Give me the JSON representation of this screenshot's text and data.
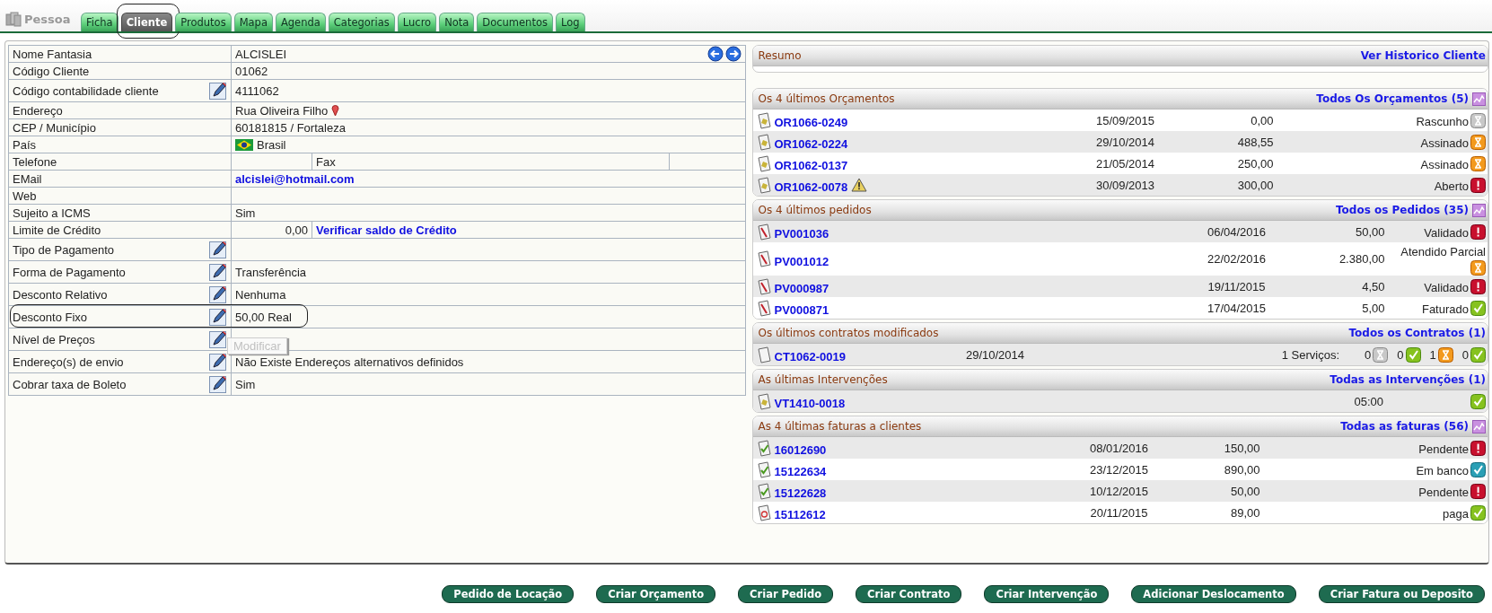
{
  "header": {
    "title": "Pessoa"
  },
  "tabs": [
    {
      "label": "Ficha",
      "selected": false,
      "highlighted": false
    },
    {
      "label": "Cliente",
      "selected": true,
      "highlighted": true
    },
    {
      "label": "Produtos",
      "selected": false,
      "highlighted": false
    },
    {
      "label": "Mapa",
      "selected": false,
      "highlighted": false
    },
    {
      "label": "Agenda",
      "selected": false,
      "highlighted": false
    },
    {
      "label": "Categorias",
      "selected": false,
      "highlighted": false
    },
    {
      "label": "Lucro",
      "selected": false,
      "highlighted": false
    },
    {
      "label": "Nota",
      "selected": false,
      "highlighted": false
    },
    {
      "label": "Documentos",
      "selected": false,
      "highlighted": false
    },
    {
      "label": "Log",
      "selected": false,
      "highlighted": false
    }
  ],
  "fields": [
    {
      "kind": "nav",
      "label": "Nome Fantasia",
      "value": "ALCISLEI",
      "editable": false
    },
    {
      "kind": "text",
      "label": "Código Cliente",
      "value": "01062",
      "editable": false
    },
    {
      "kind": "text",
      "label": "Código contabilidade cliente",
      "value": "4111062",
      "editable": true
    },
    {
      "kind": "address",
      "label": "Endereço",
      "value": "Rua Oliveira Filho",
      "editable": false
    },
    {
      "kind": "text",
      "label": "CEP / Município",
      "value": "60181815 / Fortaleza",
      "editable": false
    },
    {
      "kind": "country",
      "label": "País",
      "value": "Brasil",
      "editable": false
    },
    {
      "kind": "phone",
      "label": "Telefone",
      "fax_label": "Fax",
      "editable": false
    },
    {
      "kind": "email",
      "label": "EMail",
      "value": "alcislei@hotmail.com",
      "editable": false
    },
    {
      "kind": "text",
      "label": "Web",
      "editable": false
    },
    {
      "kind": "text",
      "label": "Sujeito a ICMS",
      "value": "Sim",
      "editable": false
    },
    {
      "kind": "credit",
      "label": "Limite de Crédito",
      "value": "0,00",
      "link": "Verificar saldo de Crédito",
      "editable": false
    },
    {
      "kind": "text",
      "label": "Tipo de Pagamento",
      "editable": true
    },
    {
      "kind": "text",
      "label": "Forma de Pagamento",
      "value": "Transferência",
      "editable": true
    },
    {
      "kind": "text",
      "label": "Desconto Relativo",
      "value": "Nenhuma",
      "editable": true
    },
    {
      "kind": "text",
      "label": "Desconto Fixo",
      "value": "50,00 Real",
      "editable": true,
      "highlighted": true
    },
    {
      "kind": "text",
      "label": "Nível de Preços",
      "editable": true
    },
    {
      "kind": "text",
      "label": "Endereço(s) de envio",
      "value": "Não Existe Endereços alternativos definidos",
      "editable": true
    },
    {
      "kind": "text",
      "label": "Cobrar taxa de Boleto",
      "value": "Sim",
      "editable": true
    }
  ],
  "tooltip": {
    "text": "Modificar"
  },
  "sections": [
    {
      "kind": "summary",
      "title": "Resumo",
      "link": "Ver Historico Cliente",
      "graph_icon": false
    },
    {
      "kind": "quotes",
      "title": "Os 4 últimos Orçamentos",
      "link": "Todos Os Orçamentos (5)",
      "graph_icon": true,
      "rows": [
        {
          "kind": "quote",
          "ref": "OR1066-0249",
          "warning": false,
          "date": "15/09/2015",
          "amount": "0,00",
          "status_text": "Rascunho",
          "status": {
            "kind": "draft"
          }
        },
        {
          "kind": "quote",
          "ref": "OR1062-0224",
          "warning": false,
          "date": "29/10/2014",
          "amount": "488,55",
          "status_text": "Assinado",
          "status": {
            "kind": "waiting"
          }
        },
        {
          "kind": "quote",
          "ref": "OR1062-0137",
          "warning": false,
          "date": "21/05/2014",
          "amount": "250,00",
          "status_text": "Assinado",
          "status": {
            "kind": "waiting"
          }
        },
        {
          "kind": "quote",
          "ref": "OR1062-0078",
          "warning": true,
          "date": "30/09/2013",
          "amount": "300,00",
          "status_text": "Aberto",
          "status": {
            "kind": "alert"
          }
        }
      ]
    },
    {
      "kind": "orders",
      "title": "Os 4 últimos pedidos",
      "link": "Todos os Pedidos (35)",
      "graph_icon": true,
      "rows": [
        {
          "kind": "order",
          "ref": "PV001036",
          "warning": false,
          "date": "06/04/2016",
          "amount": "50,00",
          "status_text": "Validado",
          "status": {
            "kind": "alert"
          }
        },
        {
          "kind": "order",
          "ref": "PV001012",
          "warning": false,
          "date": "22/02/2016",
          "amount": "2.380,00",
          "status_text": "Atendido Parcial",
          "status": {
            "kind": "waiting"
          }
        },
        {
          "kind": "order",
          "ref": "PV000987",
          "warning": false,
          "date": "19/11/2015",
          "amount": "4,50",
          "status_text": "Validado",
          "status": {
            "kind": "alert"
          }
        },
        {
          "kind": "order",
          "ref": "PV000871",
          "warning": false,
          "date": "17/04/2015",
          "amount": "5,00",
          "status_text": "Faturado",
          "status": {
            "kind": "done"
          }
        }
      ]
    },
    {
      "kind": "contracts",
      "title": "Os últimos contratos modificados",
      "link": "Todos os Contratos (1)",
      "graph_icon": false,
      "rows": [
        {
          "kind": "contract",
          "ref": "CT1062-0019",
          "warning": false,
          "date": "29/10/2014",
          "services_label": "1 Serviços:",
          "counts": [
            {
              "value": "0",
              "kind": "draft"
            },
            {
              "value": "0",
              "kind": "done"
            },
            {
              "value": "1",
              "kind": "waiting"
            },
            {
              "value": "0",
              "kind": "done"
            }
          ]
        }
      ]
    },
    {
      "kind": "interventions",
      "title": "As últimas Intervenções",
      "link": "Todas as Intervenções (1)",
      "graph_icon": false,
      "rows": [
        {
          "kind": "intervention",
          "ref": "VT1410-0018",
          "warning": false,
          "duration": "05:00",
          "status": {
            "kind": "done"
          }
        }
      ]
    },
    {
      "kind": "invoices",
      "title": "As 4 últimas faturas a clientes",
      "link": "Todas as faturas (56)",
      "graph_icon": true,
      "rows": [
        {
          "kind": "invoice",
          "ref": "16012690",
          "warning": false,
          "date": "08/01/2016",
          "amount": "150,00",
          "status_text": "Pendente",
          "status": {
            "kind": "alert"
          }
        },
        {
          "kind": "invoice",
          "ref": "15122634",
          "warning": false,
          "date": "23/12/2015",
          "amount": "890,00",
          "status_text": "Em banco",
          "status": {
            "kind": "bank"
          }
        },
        {
          "kind": "invoice",
          "ref": "15122628",
          "warning": false,
          "date": "10/12/2015",
          "amount": "50,00",
          "status_text": "Pendente",
          "status": {
            "kind": "alert"
          }
        },
        {
          "kind": "mail",
          "ref": "15112612",
          "warning": false,
          "date": "20/11/2015",
          "amount": "89,00",
          "status_text": "paga",
          "status": {
            "kind": "done"
          }
        }
      ]
    }
  ],
  "actions": [
    "Pedido de Locação",
    "Criar Orçamento",
    "Criar Pedido",
    "Criar Contrato",
    "Criar Intervenção",
    "Adicionar Deslocamento",
    "Criar Fatura ou Deposito"
  ]
}
